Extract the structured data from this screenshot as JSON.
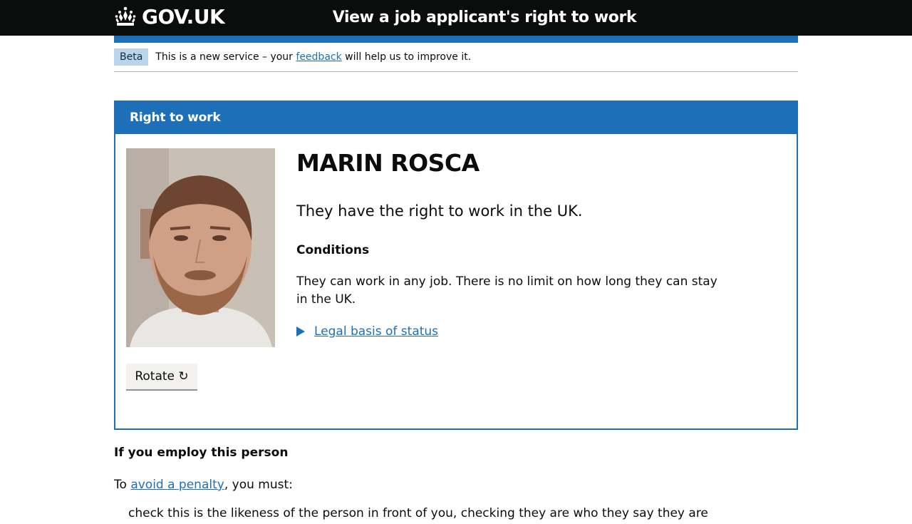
{
  "header": {
    "logo_text": "GOV.UK",
    "service_name": "View a job applicant's right to work"
  },
  "phase_banner": {
    "tag": "Beta",
    "text_before": "This is a new service – your ",
    "link_text": "feedback",
    "text_after": " will help us to improve it."
  },
  "panel": {
    "heading": "Right to work",
    "person_name": "MARIN ROSCA",
    "status": "They have the right to work in the UK.",
    "conditions_heading": "Conditions",
    "conditions_text": "They can work in any job. There is no limit on how long they can stay in the UK.",
    "legal_basis_link": "Legal basis of status",
    "rotate_button": "Rotate ↻"
  },
  "employ": {
    "heading": "If you employ this person",
    "penalty_before": "To ",
    "penalty_link": "avoid a penalty",
    "penalty_after": ", you must:",
    "first_item": "check this is the likeness of the person in front of you, checking they are who they say they are"
  },
  "colors": {
    "header_bg": "#0b0c0c",
    "brand_blue": "#1d70b8",
    "tag_bg": "#bbd4ea",
    "button_bg": "#f3f2f1"
  }
}
